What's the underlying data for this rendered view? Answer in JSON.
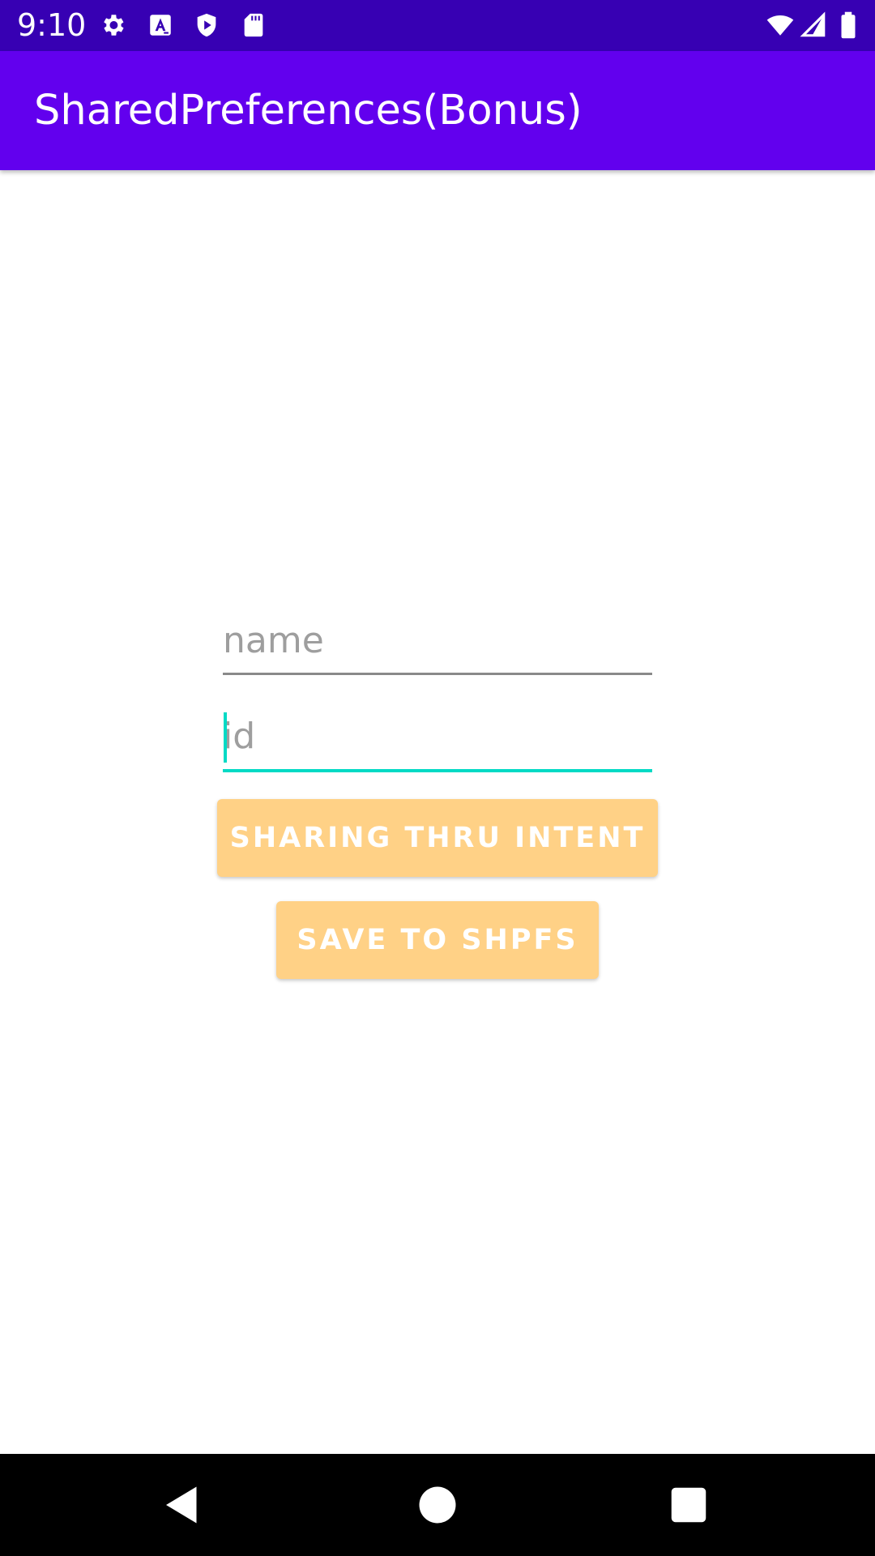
{
  "status_bar": {
    "time": "9:10",
    "icons": [
      "gear-icon",
      "text-a-icon",
      "shield-play-icon",
      "sd-card-icon",
      "wifi-icon",
      "signal-icon",
      "battery-icon"
    ]
  },
  "app_bar": {
    "title": "SharedPreferences(Bonus)"
  },
  "form": {
    "name_placeholder": "name",
    "name_value": "",
    "id_placeholder": "id",
    "id_value": ""
  },
  "buttons": {
    "share_label": "SHARING THRU INTENT",
    "save_label": "SAVE TO SHPFS"
  },
  "nav_bar": {
    "icons": [
      "back-icon",
      "home-icon",
      "recents-icon"
    ]
  },
  "colors": {
    "status_bar": "#3700b3",
    "app_bar": "#6200ee",
    "accent": "#03dac5",
    "button": "#ffd186"
  }
}
